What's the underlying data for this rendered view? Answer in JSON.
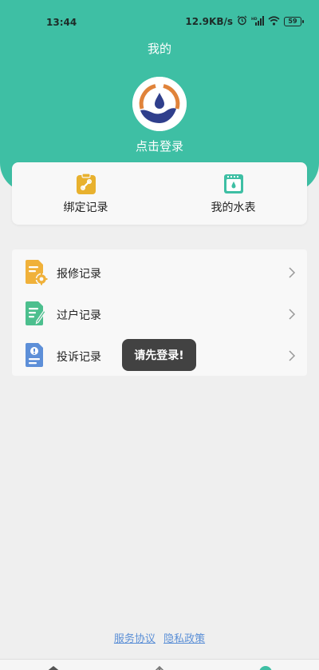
{
  "status_bar": {
    "time": "13:44",
    "speed": "12.9KB/s",
    "battery": "59",
    "icons": [
      "alarm-icon",
      "hd-signal-icon",
      "wifi-icon",
      "battery-icon"
    ]
  },
  "header": {
    "title": "我的",
    "login_text": "点击登录",
    "accent_color": "#3ebfa4"
  },
  "quick_actions": [
    {
      "label": "绑定记录",
      "icon": "clipboard-link-icon"
    },
    {
      "label": "我的水表",
      "icon": "water-meter-icon"
    }
  ],
  "records": [
    {
      "label": "报修记录",
      "icon": "repair-document-icon"
    },
    {
      "label": "过户记录",
      "icon": "transfer-document-icon"
    },
    {
      "label": "投诉记录",
      "icon": "complaint-document-icon"
    }
  ],
  "toast": {
    "text": "请先登录!"
  },
  "footer": {
    "service_agreement": "服务协议",
    "privacy_policy": "隐私政策"
  },
  "bottom_nav": {
    "icons": [
      "home-icon",
      "service-icon",
      "profile-icon"
    ]
  }
}
